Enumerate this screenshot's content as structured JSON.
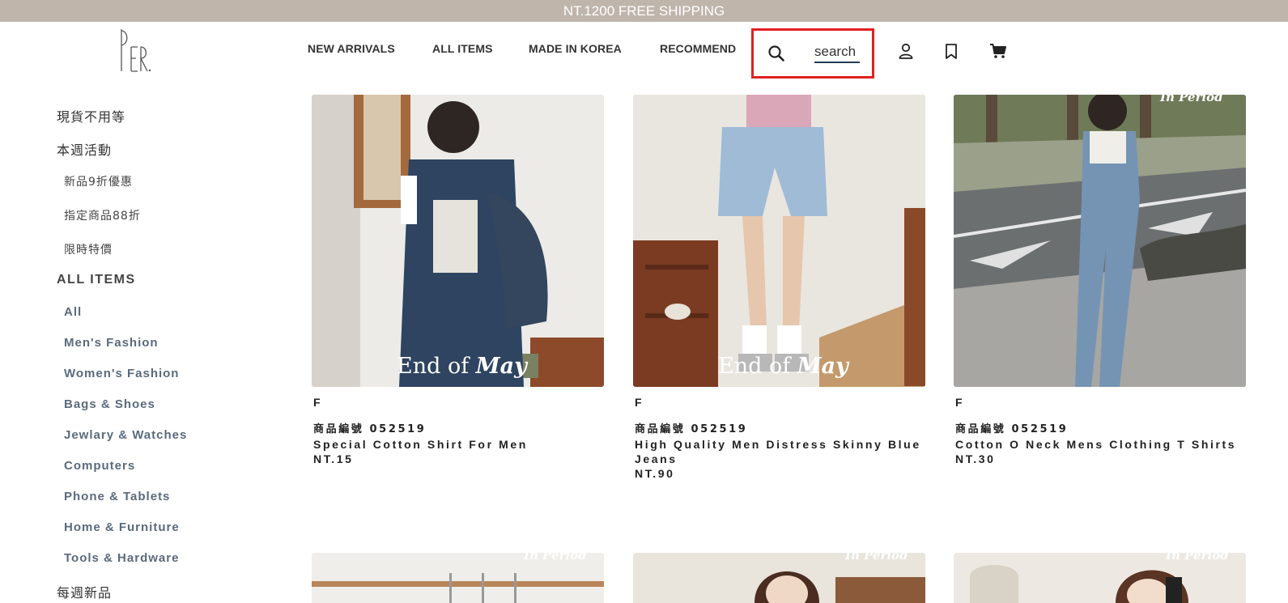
{
  "banner": {
    "text": "NT.1200 FREE SHIPPING"
  },
  "header": {
    "nav": [
      "NEW ARRIVALS",
      "ALL ITEMS",
      "MADE IN KOREA",
      "RECOMMEND"
    ],
    "search": {
      "placeholder": "search"
    },
    "icons": [
      "search-icon",
      "user-icon",
      "bookmark-icon",
      "cart-icon"
    ]
  },
  "sidebar": {
    "items": [
      {
        "label": "現貨不用等"
      },
      {
        "label": "本週活動"
      },
      {
        "label": "新品9折優惠"
      },
      {
        "label": "指定商品88折"
      },
      {
        "label": "限時特價"
      },
      {
        "label": "ALL ITEMS"
      },
      {
        "label": "All"
      },
      {
        "label": "Men's Fashion"
      },
      {
        "label": "Women's Fashion"
      },
      {
        "label": "Bags & Shoes"
      },
      {
        "label": "Jewlary & Watches"
      },
      {
        "label": "Computers"
      },
      {
        "label": "Phone & Tablets"
      },
      {
        "label": "Home & Furniture"
      },
      {
        "label": "Tools & Hardware"
      },
      {
        "label": "每週新品"
      }
    ]
  },
  "products": [
    {
      "overlay_a": "End of ",
      "overlay_b": "May",
      "size": "F",
      "code": "商品編號 052519",
      "name": "Special Cotton Shirt For Men",
      "price": "NT.15"
    },
    {
      "overlay_a": "End of ",
      "overlay_b": "May",
      "size": "F",
      "code": "商品編號 052519",
      "name": "High Quality Men Distress Skinny Blue Jeans",
      "price": "NT.90"
    },
    {
      "overlay_a": "In Period",
      "overlay_b": "",
      "size": "F",
      "code": "商品編號 052519",
      "name": "Cotton O Neck Mens Clothing T Shirts",
      "price": "NT.30"
    }
  ],
  "bottom_overlays": [
    "In Period",
    "In Period",
    "In Period"
  ],
  "colors": {
    "banner": "#bfb5ab",
    "highlight": "#e02020",
    "search_underline": "#243b53"
  }
}
